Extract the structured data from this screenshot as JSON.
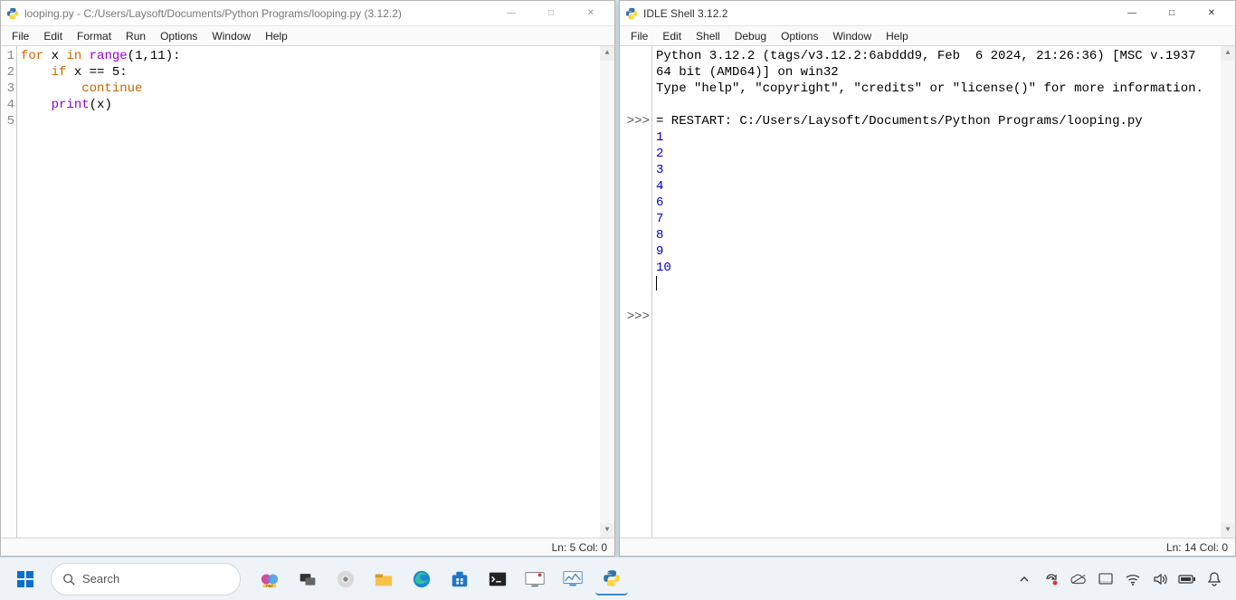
{
  "editor": {
    "title": "looping.py - C:/Users/Laysoft/Documents/Python Programs/looping.py (3.12.2)",
    "menus": [
      "File",
      "Edit",
      "Format",
      "Run",
      "Options",
      "Window",
      "Help"
    ],
    "gutter": [
      "1",
      "2",
      "3",
      "4",
      "5"
    ],
    "code": {
      "line1": {
        "kw1": "for",
        "v1": " x ",
        "kw2": "in",
        "call": " range",
        "paren": "(",
        "a1": "1",
        "comma": ",",
        "a2": "11",
        "close": "):"
      },
      "line2": {
        "indent": "    ",
        "kw": "if",
        "rest": " x == ",
        "val": "5",
        "colon": ":"
      },
      "line3": {
        "indent": "        ",
        "kw": "continue"
      },
      "line4": {
        "indent": "    ",
        "fn": "print",
        "open": "(",
        "arg": "x",
        "close": ")"
      }
    },
    "status": "Ln: 5  Col: 0"
  },
  "shell": {
    "title": "IDLE Shell 3.12.2",
    "menus": [
      "File",
      "Edit",
      "Shell",
      "Debug",
      "Options",
      "Window",
      "Help"
    ],
    "banner1": "Python 3.12.2 (tags/v3.12.2:6abddd9, Feb  6 2024, 21:26:36) [MSC v.1937 64 bit (AMD64)] on win32",
    "banner2": "Type \"help\", \"copyright\", \"credits\" or \"license()\" for more information.",
    "restart": "= RESTART: C:/Users/Laysoft/Documents/Python Programs/looping.py",
    "outputs": [
      "1",
      "2",
      "3",
      "4",
      "6",
      "7",
      "8",
      "9",
      "10"
    ],
    "prompt": ">>>",
    "status": "Ln: 14  Col: 0"
  },
  "win_controls": {
    "min": "—",
    "max": "□",
    "close": "✕"
  },
  "taskbar": {
    "search_placeholder": "Search"
  }
}
